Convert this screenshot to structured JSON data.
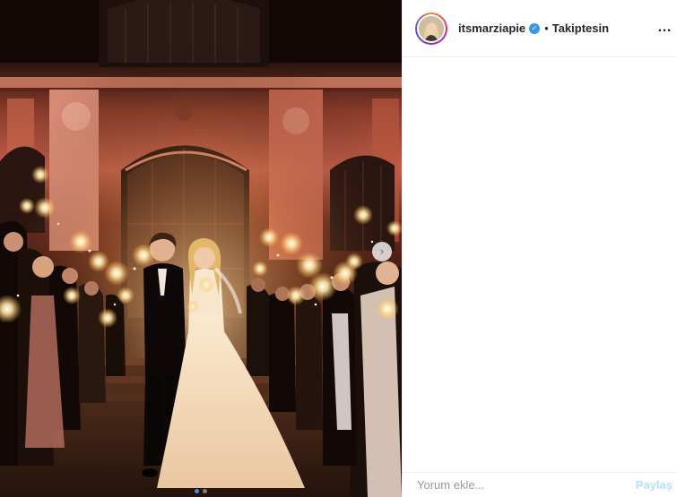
{
  "post": {
    "username": "itsmarziapie",
    "separator": "•",
    "follow_label": "Takiptesin",
    "more_label": "…",
    "verified_badge": "✓"
  },
  "comment": {
    "placeholder": "Yorum ekle...",
    "share_label": "Paylaş"
  },
  "carousel": {
    "next_glyph": "›",
    "slide_count": 2,
    "active_slide": 1
  },
  "icons": {
    "verified": "verified-badge-icon",
    "more": "more-options-icon",
    "next": "chevron-right-icon"
  },
  "colors": {
    "accent": "#3897f0",
    "share_disabled": "#b2dffc",
    "text": "#262626"
  }
}
